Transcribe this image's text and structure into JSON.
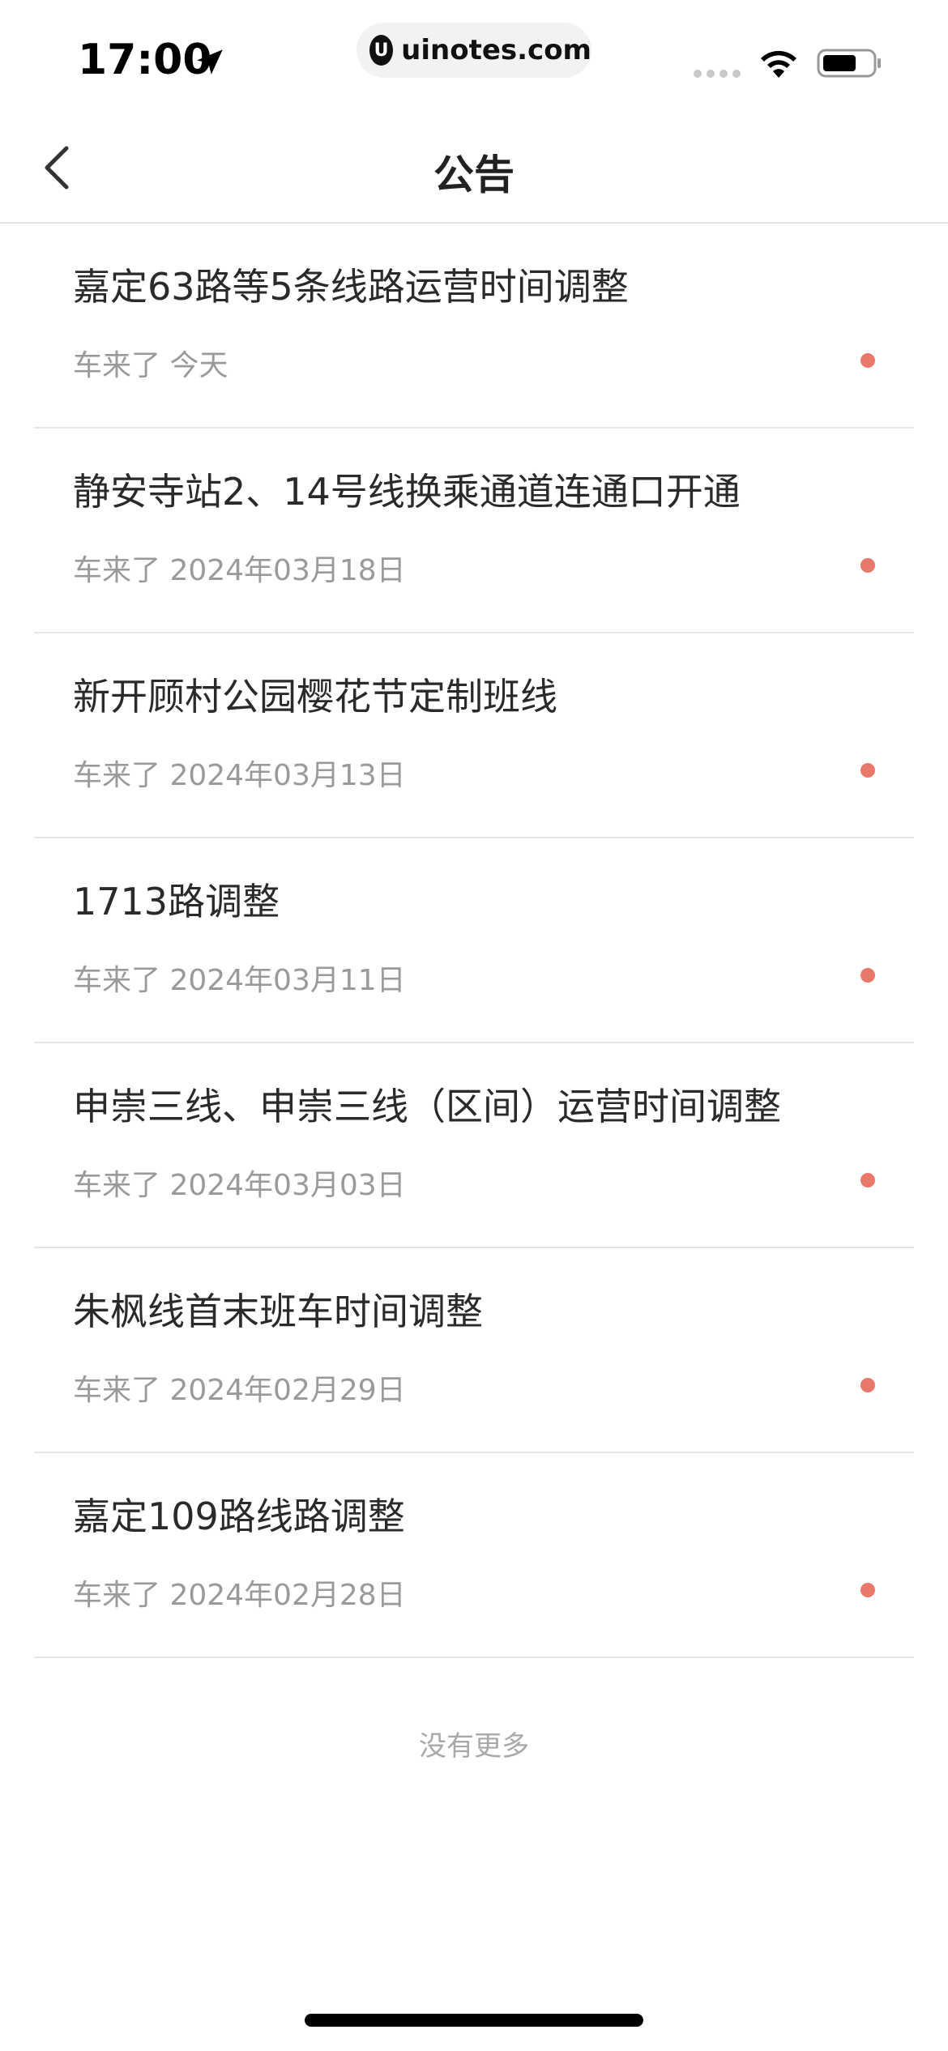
{
  "status_bar": {
    "time": "17:00",
    "url": "uinotes.com",
    "icons": [
      "location-arrow-icon",
      "signal-dots-icon",
      "wifi-icon",
      "battery-icon"
    ]
  },
  "nav": {
    "title": "公告",
    "back_icon": "chevron-left-icon"
  },
  "notices": [
    {
      "title": "嘉定63路等5条线路运营时间调整",
      "meta": "车来了 今天",
      "unread": true
    },
    {
      "title": "静安寺站2、14号线换乘通道连通口开通",
      "meta": "车来了 2024年03月18日",
      "unread": true
    },
    {
      "title": "新开顾村公园樱花节定制班线",
      "meta": "车来了 2024年03月13日",
      "unread": true
    },
    {
      "title": "1713路调整",
      "meta": "车来了 2024年03月11日",
      "unread": true
    },
    {
      "title": "申崇三线、申崇三线（区间）运营时间调整",
      "meta": "车来了 2024年03月03日",
      "unread": true
    },
    {
      "title": "朱枫线首末班车时间调整",
      "meta": "车来了 2024年02月29日",
      "unread": true
    },
    {
      "title": "嘉定109路线路调整",
      "meta": "车来了 2024年02月28日",
      "unread": true
    }
  ],
  "footer": {
    "no_more": "没有更多"
  },
  "colors": {
    "unread_dot": "#e8796a",
    "divider": "#e6e6e6",
    "meta_text": "#9a9a9a"
  }
}
